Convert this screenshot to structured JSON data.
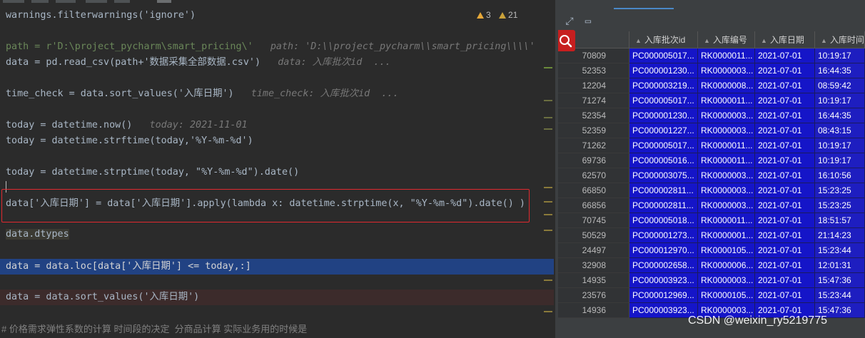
{
  "editor": {
    "warnings": {
      "errors": "3",
      "warns": "21"
    },
    "lines": {
      "l1": "warnings.filterwarnings('ignore')",
      "l2_code": "path = r'D:\\project_pycharm\\smart_pricing\\'",
      "l2_hint": "path: 'D:\\\\project_pycharm\\\\smart_pricing\\\\\\\\'",
      "l3_code": "data = pd.read_csv(path+'数据采集全部数据.csv')",
      "l3_hint": "data: 入库批次id  ...",
      "l4_code": "time_check = data.sort_values('入库日期')",
      "l4_hint": "time_check: 入库批次id  ...",
      "l5_code": "today = datetime.now()",
      "l5_hint": "today: 2021-11-01",
      "l6": "today = datetime.strftime(today,'%Y-%m-%d')",
      "l7": "today = datetime.strptime(today, \"%Y-%m-%d\").date()",
      "l8": "data['入库日期'] = data['入库日期'].apply(lambda x: datetime.strptime(x, \"%Y-%m-%d\").date() )",
      "l9": "data.dtypes",
      "l10": "data = data.loc[data['入库日期'] <= today,:]",
      "l11": "data = data.sort_values('入库日期')"
    },
    "bottom_text": "# 价格需求弹性系数的计算 时间段的决定  分商品计算 实际业务用的时候是"
  },
  "grid": {
    "headers": [
      "入库批次id",
      "入库编号",
      "入库日期",
      "入库时间"
    ],
    "rows": [
      [
        "70809",
        "PC000005017...",
        "RK0000011...",
        "2021-07-01",
        "10:19:17"
      ],
      [
        "52353",
        "PC000001230...",
        "RK0000003...",
        "2021-07-01",
        "16:44:35"
      ],
      [
        "12204",
        "PC000003219...",
        "RK0000008...",
        "2021-07-01",
        "08:59:42"
      ],
      [
        "71274",
        "PC000005017...",
        "RK0000011...",
        "2021-07-01",
        "10:19:17"
      ],
      [
        "52354",
        "PC000001230...",
        "RK0000003...",
        "2021-07-01",
        "16:44:35"
      ],
      [
        "52359",
        "PC000001227...",
        "RK0000003...",
        "2021-07-01",
        "08:43:15"
      ],
      [
        "71262",
        "PC000005017...",
        "RK0000011...",
        "2021-07-01",
        "10:19:17"
      ],
      [
        "69736",
        "PC000005016...",
        "RK0000011...",
        "2021-07-01",
        "10:19:17"
      ],
      [
        "62570",
        "PC000003075...",
        "RK0000003...",
        "2021-07-01",
        "16:10:56"
      ],
      [
        "66850",
        "PC000002811...",
        "RK0000003...",
        "2021-07-01",
        "15:23:25"
      ],
      [
        "66856",
        "PC000002811...",
        "RK0000003...",
        "2021-07-01",
        "15:23:25"
      ],
      [
        "70745",
        "PC000005018...",
        "RK0000011...",
        "2021-07-01",
        "18:51:57"
      ],
      [
        "50529",
        "PC000001273...",
        "RK0000001...",
        "2021-07-01",
        "21:14:23"
      ],
      [
        "24497",
        "PC000012970...",
        "RK0000105...",
        "2021-07-01",
        "15:23:44"
      ],
      [
        "32908",
        "PC000002658...",
        "RK0000006...",
        "2021-07-01",
        "12:01:31"
      ],
      [
        "14935",
        "PC000003923...",
        "RK0000003...",
        "2021-07-01",
        "15:47:36"
      ],
      [
        "23576",
        "PC000012969...",
        "RK0000105...",
        "2021-07-01",
        "15:23:44"
      ],
      [
        "14936",
        "PC000003923...",
        "RK0000003...",
        "2021-07-01",
        "15:47:36"
      ]
    ]
  },
  "watermark": "CSDN @weixin_ry5219775",
  "colors": {
    "accent": "#214283",
    "selection": "#1515c8",
    "highlight_box": "#e0292f"
  }
}
